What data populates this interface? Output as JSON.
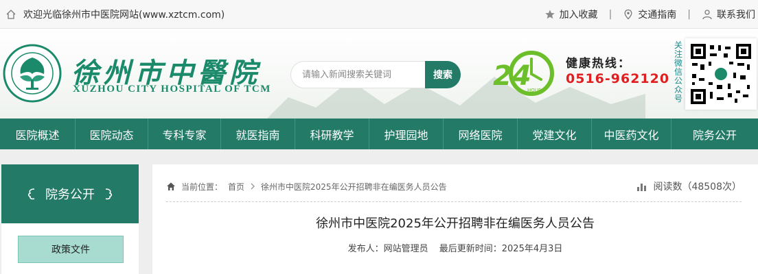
{
  "topbar": {
    "welcome": "欢迎光临徐州市中医院网站(www.xztcm.com)",
    "favorite": "加入收藏",
    "traffic": "交通指南",
    "contact": "联系我们",
    "separator": "|"
  },
  "header": {
    "brand_cn": "徐州市中醫院",
    "brand_en": "XUZHOU CITY HOSPITAL OF TCM",
    "search_placeholder": "请输入新闻搜索关键词",
    "search_button": "搜索",
    "clock_digits": "24",
    "clock_sub": "HOURS",
    "hotline_label": "健康热线：",
    "hotline_number": "0516-962120",
    "follow_text": "关注微信公众号"
  },
  "nav": {
    "items": [
      {
        "label": "医院概述"
      },
      {
        "label": "医院动态"
      },
      {
        "label": "专科专家"
      },
      {
        "label": "就医指南"
      },
      {
        "label": "科研教学"
      },
      {
        "label": "护理园地"
      },
      {
        "label": "网络医院"
      },
      {
        "label": "党建文化"
      },
      {
        "label": "中医药文化"
      },
      {
        "label": "院务公开"
      }
    ]
  },
  "sidebar": {
    "title": "院务公开",
    "items": [
      {
        "label": "政策文件"
      }
    ]
  },
  "main": {
    "crumb_prefix": "当前位置：",
    "crumb_home": "首页",
    "crumb_current": "徐州市中医院2025年公开招聘非在编医务人员公告",
    "reads": "阅读数（48508次）",
    "title": "徐州市中医院2025年公开招聘非在编医务人员公告",
    "publisher": "发布人：网站管理员",
    "updated": "最后更新时间：2025年4月3日"
  },
  "colors": {
    "brand_green": "#237a67",
    "hotline_red": "#e02020",
    "side_item_bg": "#a8dcd0"
  }
}
